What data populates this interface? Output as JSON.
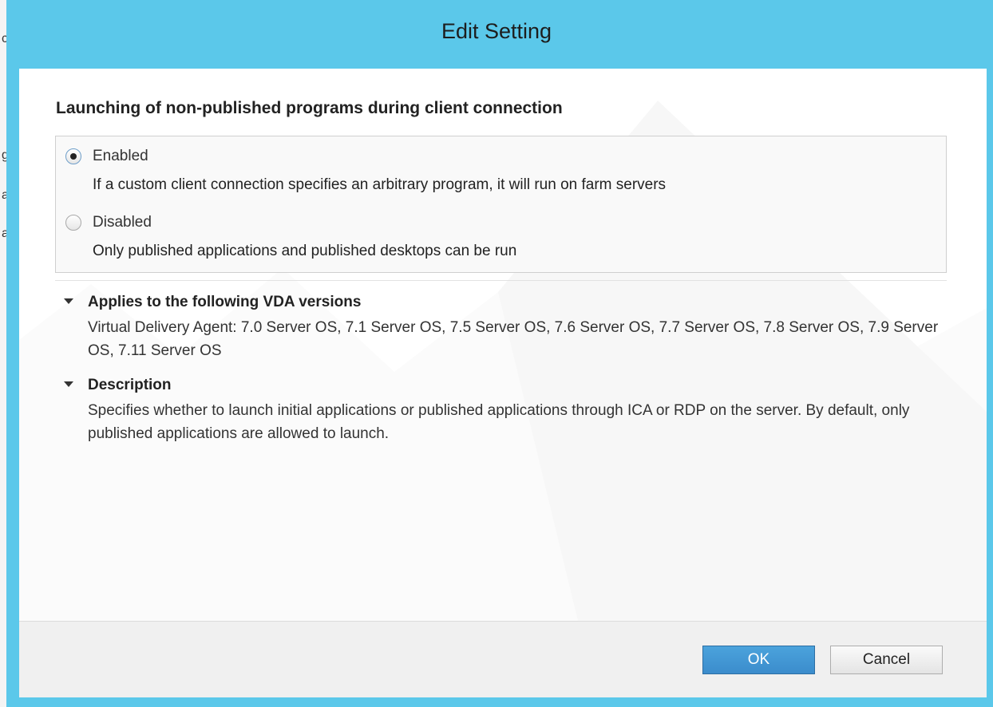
{
  "dialog": {
    "title": "Edit Setting"
  },
  "background_window": {
    "edge_letters": [
      "c",
      "g",
      "a",
      "a"
    ]
  },
  "setting": {
    "name": "Launching of non-published programs during client connection",
    "options": [
      {
        "label": "Enabled",
        "description": "If a custom client connection specifies an arbitrary program, it will run on farm servers",
        "selected": true
      },
      {
        "label": "Disabled",
        "description": "Only published applications and published desktops can be run",
        "selected": false
      }
    ]
  },
  "sections": {
    "versions": {
      "heading": "Applies to the following VDA versions",
      "text": "Virtual Delivery Agent: 7.0 Server OS, 7.1 Server OS, 7.5 Server OS, 7.6 Server OS, 7.7 Server OS, 7.8 Server OS, 7.9 Server OS, 7.11 Server OS",
      "expanded": true
    },
    "description": {
      "heading": "Description",
      "text": "Specifies whether to launch initial applications or published applications  through ICA or RDP on the server. By default, only published applications are allowed to launch.",
      "expanded": true
    }
  },
  "buttons": {
    "ok_label": "OK",
    "cancel_label": "Cancel"
  },
  "colors": {
    "title_bar": "#5bc8ea",
    "ok_button": "#3b8ccc",
    "footer": "#f0f0f0"
  }
}
